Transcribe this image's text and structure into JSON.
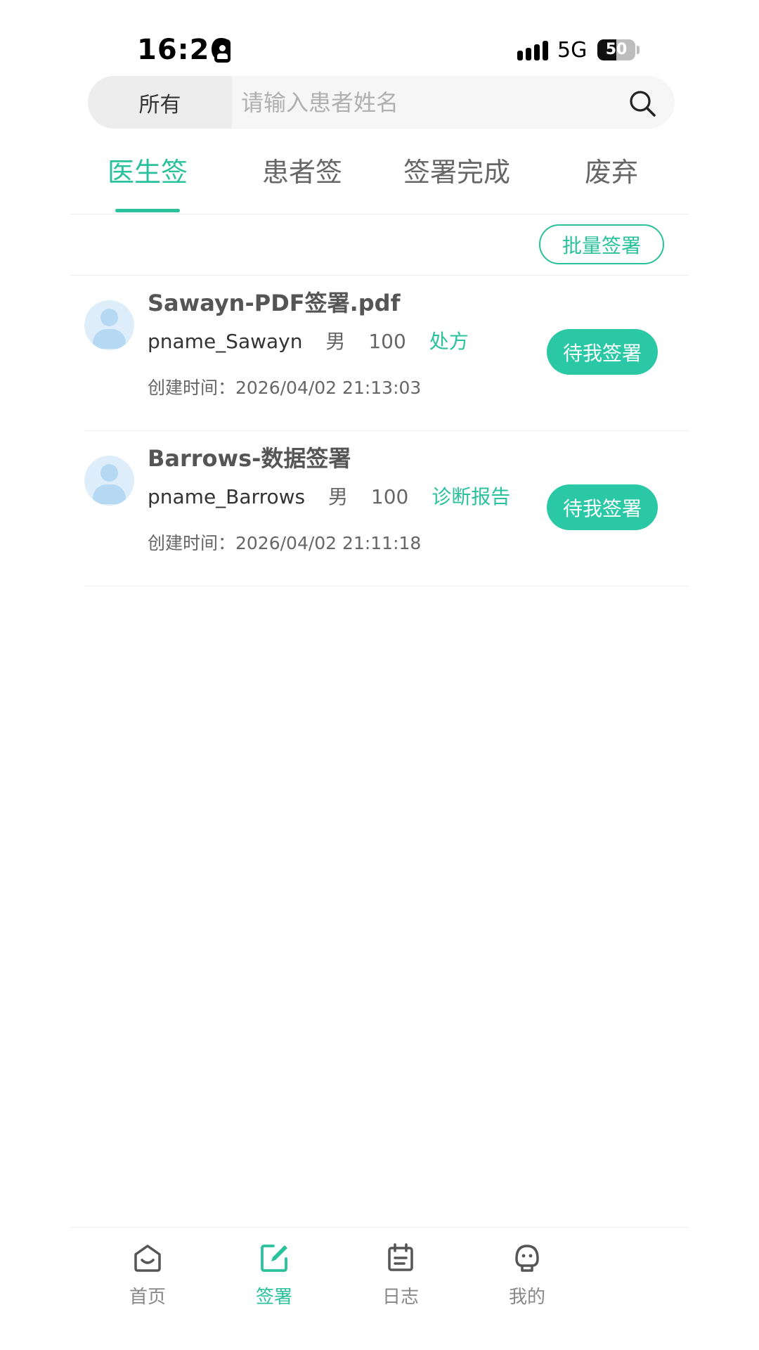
{
  "status_bar": {
    "time": "16:26",
    "network": "5G",
    "battery": "50",
    "battery_level": 0.5,
    "icons": [
      "id-badge-icon",
      "signal-icon",
      "battery-icon"
    ]
  },
  "search": {
    "filter_label": "所有",
    "placeholder": "请输入患者姓名",
    "value": "",
    "icon": "search-icon"
  },
  "tabs": [
    {
      "label": "医生签",
      "active": true
    },
    {
      "label": "患者签",
      "active": false
    },
    {
      "label": "签署完成",
      "active": false
    },
    {
      "label": "废弃",
      "active": false
    }
  ],
  "batch_sign_label": "批量签署",
  "records": [
    {
      "title": "Sawayn-PDF签署.pdf",
      "patient_name": "pname_Sawayn",
      "gender": "男",
      "age": "100",
      "doc_type": "处方",
      "created_at": "创建时间：2026/04/02 21:13:03",
      "action_label": "待我签署"
    },
    {
      "title": "Barrows-数据签署",
      "patient_name": "pname_Barrows",
      "gender": "男",
      "age": "100",
      "doc_type": "诊断报告",
      "created_at": "创建时间：2026/04/02 21:11:18",
      "action_label": "待我签署"
    }
  ],
  "bottom_nav": [
    {
      "label": "首页",
      "icon": "home-icon",
      "active": false
    },
    {
      "label": "签署",
      "icon": "sign-edit-icon",
      "active": true
    },
    {
      "label": "日志",
      "icon": "calendar-log-icon",
      "active": false
    },
    {
      "label": "我的",
      "icon": "profile-face-icon",
      "active": false
    }
  ],
  "colors": {
    "accent": "#2bc19c",
    "action_button": "#2ac8a5",
    "avatar_bg": "#ddeefa",
    "avatar_fg": "#b5d9f2"
  }
}
